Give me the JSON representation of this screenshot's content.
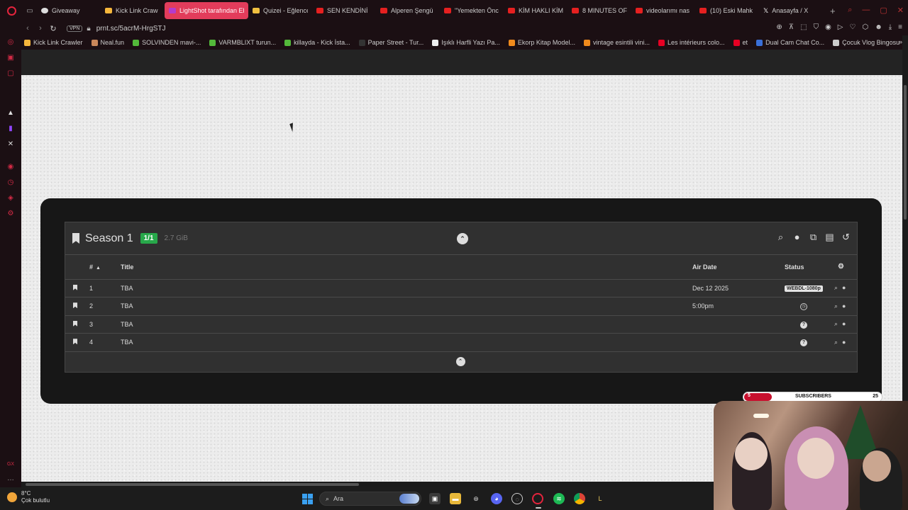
{
  "browser": {
    "tabs": [
      {
        "label": "Giveaway",
        "icon": "gift-icon",
        "active": false
      },
      {
        "label": "Kick Link Craw",
        "icon": "kick-icon",
        "active": false
      },
      {
        "label": "LightShot tarafından Ekra",
        "icon": "lightshot-icon",
        "active": true
      },
      {
        "label": "Quizei - Eğlence",
        "icon": "quiz-icon",
        "active": false
      },
      {
        "label": "SEN KENDİNİ",
        "icon": "youtube-icon",
        "active": false
      },
      {
        "label": "Alperen Şengü",
        "icon": "youtube-icon",
        "active": false
      },
      {
        "label": "\"Yemekten Önc",
        "icon": "youtube-icon",
        "active": false
      },
      {
        "label": "KİM HAKLI KİM",
        "icon": "youtube-icon",
        "active": false
      },
      {
        "label": "8 MINUTES OF",
        "icon": "youtube-icon",
        "active": false
      },
      {
        "label": "videolarımı nas",
        "icon": "youtube-icon",
        "active": false
      },
      {
        "label": "(10) Eski Mahk",
        "icon": "youtube-icon",
        "active": false
      },
      {
        "label": "Anasayfa / X",
        "icon": "x-icon",
        "active": false
      }
    ],
    "new_tab": "+",
    "url": "prnt.sc/5acrM-HrgSTJ",
    "vpn": "VPN",
    "bookmarks": [
      {
        "label": "Kick Link Crawler",
        "color": "#f6b73c"
      },
      {
        "label": "Neal.fun",
        "color": "#c9875a"
      },
      {
        "label": "SOLVINDEN mavi-...",
        "color": "#53b83a"
      },
      {
        "label": "VARMBLIXT turun...",
        "color": "#53b83a"
      },
      {
        "label": "killayda - Kick İsta...",
        "color": "#53b83a"
      },
      {
        "label": "Paper Street - Tur...",
        "color": "#333333"
      },
      {
        "label": "Işıklı Harfli Yazı Pa...",
        "color": "#eeeeee"
      },
      {
        "label": "Ekorp Kitap Model...",
        "color": "#f08a1c"
      },
      {
        "label": "vintage esintili vini...",
        "color": "#f08a1c"
      },
      {
        "label": "Les intérieurs colo...",
        "color": "#e60023"
      },
      {
        "label": "et",
        "color": "#e60023"
      },
      {
        "label": "Dual Cam Chat Co...",
        "color": "#3a6fd8"
      },
      {
        "label": "Çocuk Vlog Bingosu",
        "color": "#cccccc"
      }
    ]
  },
  "season": {
    "title": "Season 1",
    "episode_count": "1/1",
    "size": "2.7 GiB",
    "columns": {
      "num": "#",
      "title": "Title",
      "air_date": "Air Date",
      "status": "Status"
    },
    "episodes": [
      {
        "num": "1",
        "title": "TBA",
        "air_date": "Dec 12 2025",
        "status": "WEBDL-1080p",
        "status_type": "quality"
      },
      {
        "num": "2",
        "title": "TBA",
        "air_date": "5:00pm",
        "status": "",
        "status_type": "clock"
      },
      {
        "num": "3",
        "title": "TBA",
        "air_date": "",
        "status": "?",
        "status_type": "help"
      },
      {
        "num": "4",
        "title": "TBA",
        "air_date": "",
        "status": "?",
        "status_type": "help"
      }
    ]
  },
  "overlay": {
    "subscribers_label": "SUBSCRIBERS",
    "current": "5",
    "goal": "25",
    "progress": 0.2
  },
  "taskbar": {
    "temperature": "8°C",
    "weather": "Çok bulutlu",
    "search": "Ara"
  }
}
